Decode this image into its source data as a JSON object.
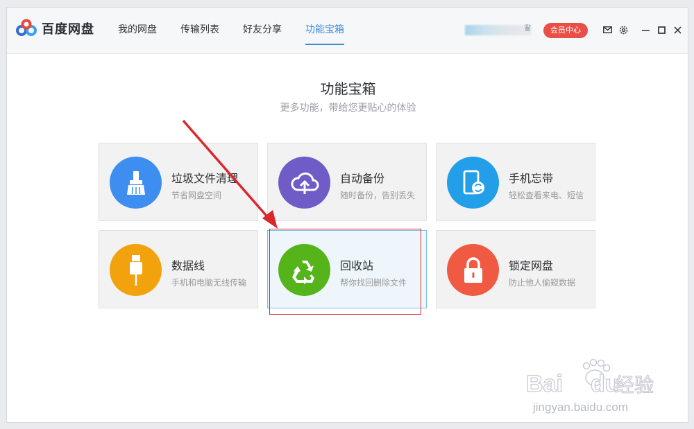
{
  "app": {
    "name": "百度网盘"
  },
  "nav": {
    "items": [
      {
        "label": "我的网盘"
      },
      {
        "label": "传输列表"
      },
      {
        "label": "好友分享"
      },
      {
        "label": "功能宝箱",
        "active": true
      }
    ]
  },
  "header": {
    "member_label": "会员中心"
  },
  "main": {
    "title": "功能宝箱",
    "subtitle": "更多功能，带给您更贴心的体验"
  },
  "tools": [
    {
      "title": "垃圾文件清理",
      "desc": "节省网盘空间",
      "icon": "broom-icon",
      "color": "#3d8ef0"
    },
    {
      "title": "自动备份",
      "desc": "随时备份，告别丢失",
      "icon": "cloud-upload-icon",
      "color": "#6f5cc6"
    },
    {
      "title": "手机忘带",
      "desc": "轻松查看来电、短信",
      "icon": "phone-sync-icon",
      "color": "#229fe8"
    },
    {
      "title": "数据线",
      "desc": "手机和电脑无线传输",
      "icon": "usb-cable-icon",
      "color": "#f2a20c"
    },
    {
      "title": "回收站",
      "desc": "帮你找回删除文件",
      "icon": "recycle-icon",
      "color": "#54b419",
      "selected": true
    },
    {
      "title": "锁定网盘",
      "desc": "防止他人偷窥数据",
      "icon": "lock-icon",
      "color": "#f05a43"
    }
  ],
  "watermark": {
    "brand": "Bai",
    "brand2": "du",
    "cn": "经验",
    "url": "jingyan.baidu.com"
  }
}
